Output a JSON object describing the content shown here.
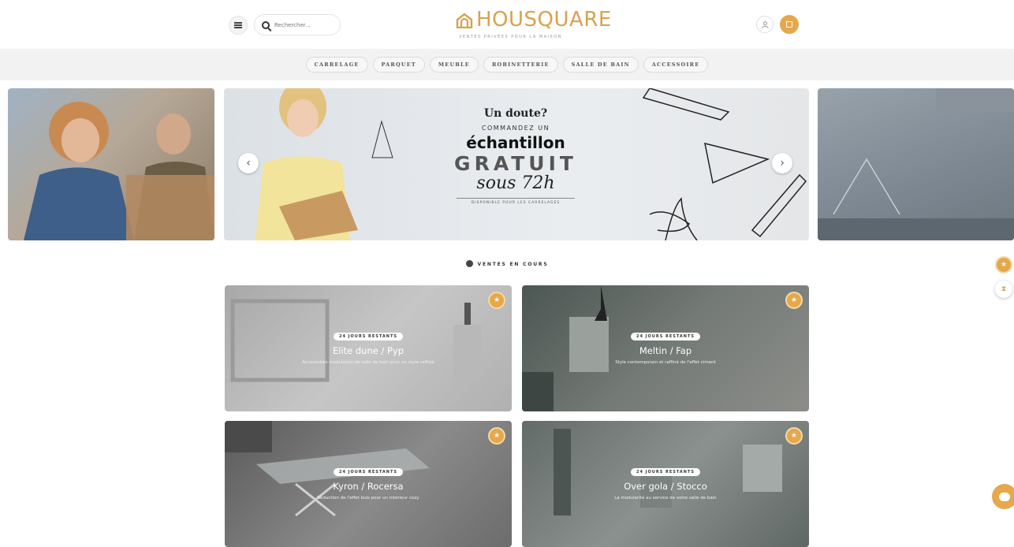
{
  "header": {
    "search_placeholder": "Rechercher...",
    "logo_text": "HOUSQUARE",
    "logo_tagline": "VENTES PRIVÉES POUR LA MAISON",
    "user_icon": "user-icon",
    "cart_icon": "cart-icon",
    "brand_color": "#d8a24e"
  },
  "categories": [
    "CARRELAGE",
    "PARQUET",
    "MEUBLE",
    "ROBINETTERIE",
    "SALLE DE BAIN",
    "ACCESSOIRE"
  ],
  "slider": {
    "promo": {
      "question": "Un doute?",
      "line1": "COMMANDEZ UN",
      "line2": "échantillon",
      "line3": "GRATUIT",
      "line4": "sous 72h",
      "note": "DISPONIBLE POUR LES CARRELAGES"
    },
    "prev_icon": "chevron-left-icon",
    "next_icon": "chevron-right-icon"
  },
  "sales": {
    "title": "VENTES EN COURS",
    "items": [
      {
        "badge": "24 JOURS RESTANTS",
        "title": "Elite dune / Pyp",
        "subtitle": "Accessoires modulaires de salle de bain pour un style raffiné"
      },
      {
        "badge": "24 JOURS RESTANTS",
        "title": "Meltin / Fap",
        "subtitle": "Style contemporain et raffiné de l'effet ciment"
      },
      {
        "badge": "24 JOURS RESTANTS",
        "title": "Kyron / Rocersa",
        "subtitle": "Séduction de l'effet bois pour un intérieur cozy"
      },
      {
        "badge": "24 JOURS RESTANTS",
        "title": "Over gola / Stocco",
        "subtitle": "La modularité au service de votre salle de bain"
      }
    ]
  }
}
